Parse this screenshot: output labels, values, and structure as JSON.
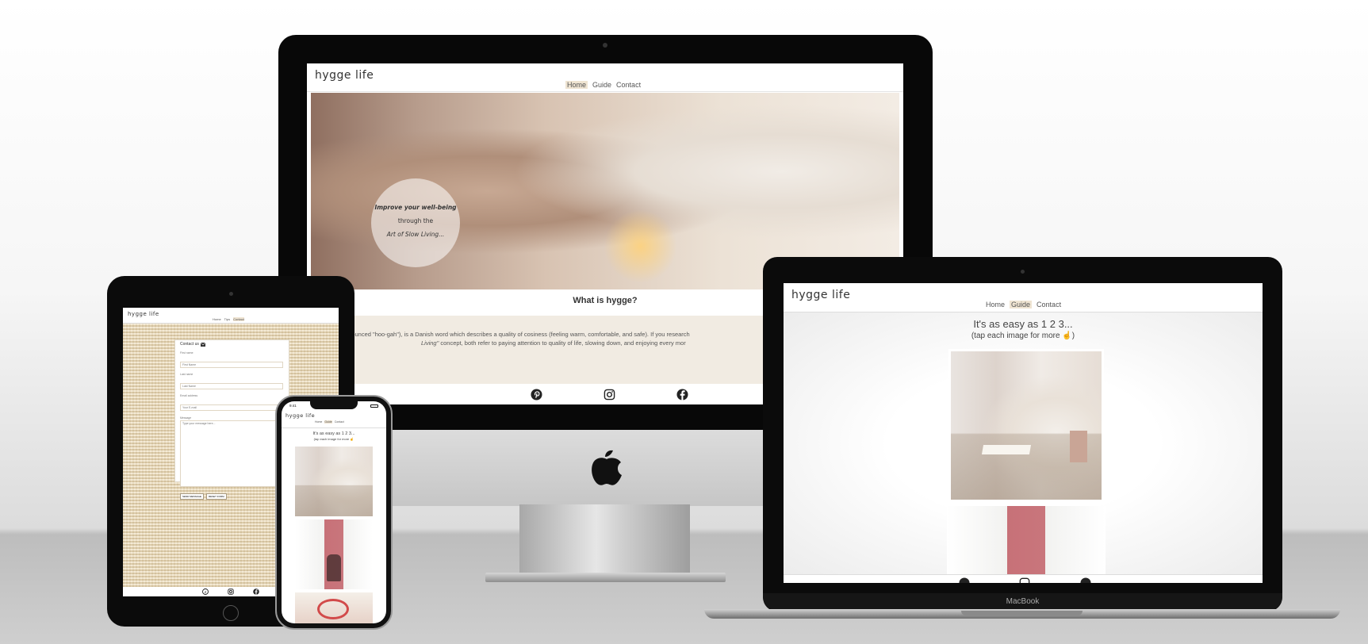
{
  "site": {
    "brand": "hygge life",
    "nav": [
      "Home",
      "Guide",
      "Contact"
    ]
  },
  "imac": {
    "active_nav": "Home",
    "hero_lines": [
      "Improve your well-being",
      "through the",
      "Art of Slow Living..."
    ],
    "section_title": "What is hygge?",
    "intro_line1": "onounced \"hoo-gah\"), is a Danish word which describes a quality of cosiness (feeling warm, comfortable, and safe). If you research",
    "intro_line2_em": "Living\"",
    "intro_line2_rest": "concept, both refer to paying attention to quality of life, slowing down, and enjoying every mor"
  },
  "macbook": {
    "active_nav": "Guide",
    "heading": "It's as easy as 1 2 3...",
    "subheading": "(tap each image for more",
    "sub_close": ")",
    "label": "MacBook"
  },
  "ipad": {
    "nav_small": [
      "Home",
      "Tips",
      "Contact"
    ],
    "form_title": "Contact us",
    "fields": [
      {
        "label": "First name",
        "placeholder": "First Name"
      },
      {
        "label": "Last name",
        "placeholder": "Last Name"
      },
      {
        "label": "Email address",
        "placeholder": "Your E-mail"
      }
    ],
    "message_label": "Message",
    "message_placeholder": "Type your message here...",
    "buttons": [
      "SEND MESSAGE",
      "RESET FORM"
    ]
  },
  "iphone": {
    "time": "9:41",
    "active_nav": "Guide",
    "heading": "It's as easy as 1 2 3...",
    "subheading": "(tap each image for more"
  },
  "icons": [
    "pinterest-icon",
    "instagram-icon",
    "facebook-icon",
    "apple-logo-icon",
    "hand-pointer-icon",
    "envelope-icon"
  ],
  "colors": {
    "nav_active_bg": "#efe4d2",
    "accent_pink": "#c9767c",
    "text": "#333333"
  }
}
